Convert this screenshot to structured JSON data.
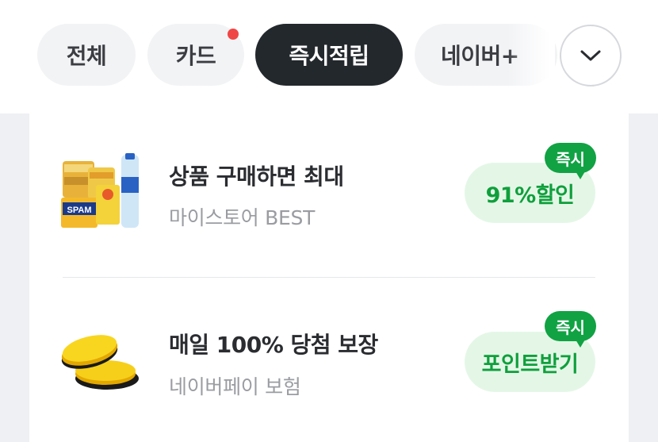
{
  "tabs": [
    {
      "label": "전체",
      "active": false
    },
    {
      "label": "카드",
      "active": false,
      "has_new_dot": true
    },
    {
      "label": "즉시적립",
      "active": true
    },
    {
      "label": "네이버+",
      "active": false
    }
  ],
  "more_button": {
    "icon": "chevron-down-icon"
  },
  "offers": [
    {
      "title": "상품 구매하면 최대",
      "subtitle": "마이스토어 BEST",
      "reward": "91%할인",
      "badge": "즉시",
      "thumbnail": "groceries-thumbnail"
    },
    {
      "title": "매일 100% 당첨 보장",
      "subtitle": "네이버페이 보험",
      "reward": "포인트받기",
      "badge": "즉시",
      "thumbnail": "gold-coins-thumbnail"
    }
  ],
  "colors": {
    "active_tab": "#23282d",
    "reward_text": "#0f9f3c",
    "reward_bg": "#e4f7e7",
    "badge_bg": "#11a243",
    "new_dot": "#f04545"
  }
}
